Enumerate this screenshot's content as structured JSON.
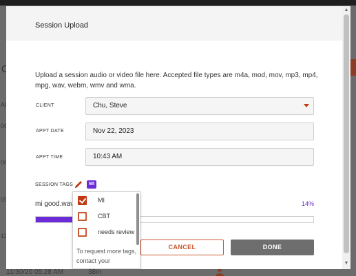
{
  "modal": {
    "title": "Session Upload",
    "description": "Upload a session audio or video file here. Accepted file types are m4a, mod, mov, mp3, mp4, mpg, wav, webm, wmv and wma."
  },
  "form": {
    "client_label": "CLIENT",
    "client_value": "Chu, Steve",
    "date_label": "APPT DATE",
    "date_value": "Nov 22, 2023",
    "time_label": "APPT TIME",
    "time_value": "10:43 AM"
  },
  "tags": {
    "label": "SESSION TAGS",
    "selected_chip": "MI",
    "options": [
      {
        "label": "MI",
        "checked": true
      },
      {
        "label": "CBT",
        "checked": false
      },
      {
        "label": "needs review",
        "checked": false
      }
    ],
    "note": "To request more tags, contact your"
  },
  "upload": {
    "file_name": "mi good.wav",
    "progress_text": "14%",
    "progress": 0.14
  },
  "buttons": {
    "cancel": "CANCEL",
    "done": "DONE"
  },
  "background": {
    "letter": "C",
    "row_labels": [
      "AP",
      "06",
      "06",
      "09",
      "12"
    ],
    "bottom_date": "11/30/20 05:28 AM",
    "bottom_duration": "38m"
  },
  "colors": {
    "accent_purple": "#6b2bd9",
    "accent_orange": "#c9572f",
    "done_gray": "#6e6e6e"
  },
  "icons": {
    "pencil": "pencil-icon",
    "caret": "chevron-down-icon",
    "checkbox_checked": "checkbox-checked-icon",
    "checkbox_empty": "checkbox-empty-icon"
  }
}
